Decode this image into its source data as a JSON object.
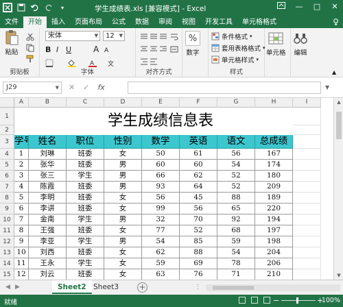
{
  "window": {
    "title": "学生成绩表.xls [兼容模式] - Excel",
    "qat": [
      "save-icon",
      "undo-icon",
      "redo-icon"
    ],
    "win_buttons": [
      "□",
      "—",
      "□",
      "✕"
    ]
  },
  "tabs": [
    "文件",
    "开始",
    "插入",
    "页面布局",
    "公式",
    "数据",
    "审阅",
    "视图",
    "开发工具",
    "单元格格式"
  ],
  "active_tab": "开始",
  "tell_me": "♀",
  "ribbon": {
    "clipboard": {
      "paste": "粘贴",
      "label": "剪贴板"
    },
    "font": {
      "name": "宋体",
      "size": "12",
      "bold": "B",
      "italic": "I",
      "underline": "U",
      "grow": "A",
      "shrink": "A",
      "label": "字体"
    },
    "alignment": {
      "label": "对齐方式"
    },
    "number": {
      "btn": "数字",
      "symbol": "%"
    },
    "styles": {
      "cond": "条件格式",
      "table": "套用表格格式",
      "cell": "单元格样式",
      "label": "样式"
    },
    "cells": {
      "btn": "单元格"
    },
    "editing": {
      "btn": "编辑"
    }
  },
  "formula_bar": {
    "name_box": "J29",
    "cancel": "✕",
    "enter": "✓",
    "fx": "fx",
    "value": ""
  },
  "sheet": {
    "columns": [
      "A",
      "B",
      "C",
      "D",
      "E",
      "F",
      "G",
      "H",
      "I"
    ],
    "rows": [
      "1",
      "2",
      "3",
      "4",
      "5",
      "6",
      "7",
      "8",
      "9",
      "10",
      "11",
      "12",
      "13",
      "14",
      "15"
    ],
    "title": "学生成绩信息表",
    "headers": [
      "学号",
      "姓名",
      "职位",
      "性别",
      "数学",
      "英语",
      "语文",
      "总成绩"
    ],
    "data": [
      [
        "1",
        "刘琳",
        "班委",
        "女",
        "50",
        "61",
        "56",
        "167"
      ],
      [
        "2",
        "张华",
        "班委",
        "男",
        "60",
        "60",
        "54",
        "174"
      ],
      [
        "3",
        "张三",
        "学生",
        "男",
        "66",
        "62",
        "52",
        "180"
      ],
      [
        "4",
        "陈霞",
        "班委",
        "男",
        "93",
        "64",
        "52",
        "209"
      ],
      [
        "5",
        "李明",
        "班委",
        "女",
        "56",
        "45",
        "88",
        "189"
      ],
      [
        "6",
        "李讲",
        "班委",
        "女",
        "99",
        "56",
        "65",
        "220"
      ],
      [
        "7",
        "金南",
        "学生",
        "男",
        "32",
        "70",
        "92",
        "194"
      ],
      [
        "8",
        "王强",
        "班委",
        "女",
        "77",
        "52",
        "68",
        "197"
      ],
      [
        "9",
        "李亚",
        "学生",
        "男",
        "54",
        "85",
        "59",
        "198"
      ],
      [
        "10",
        "刘西",
        "班委",
        "女",
        "62",
        "88",
        "54",
        "204"
      ],
      [
        "11",
        "王永",
        "学生",
        "女",
        "59",
        "69",
        "78",
        "206"
      ],
      [
        "12",
        "刘云",
        "班委",
        "女",
        "63",
        "76",
        "71",
        "210"
      ]
    ]
  },
  "sheet_tabs": [
    "Sheet2",
    "Sheet3"
  ],
  "active_sheet": "Sheet2",
  "add_sheet": "+",
  "status": {
    "ready": "就绪",
    "zoom": "100%",
    "minus": "−",
    "plus": "+"
  }
}
